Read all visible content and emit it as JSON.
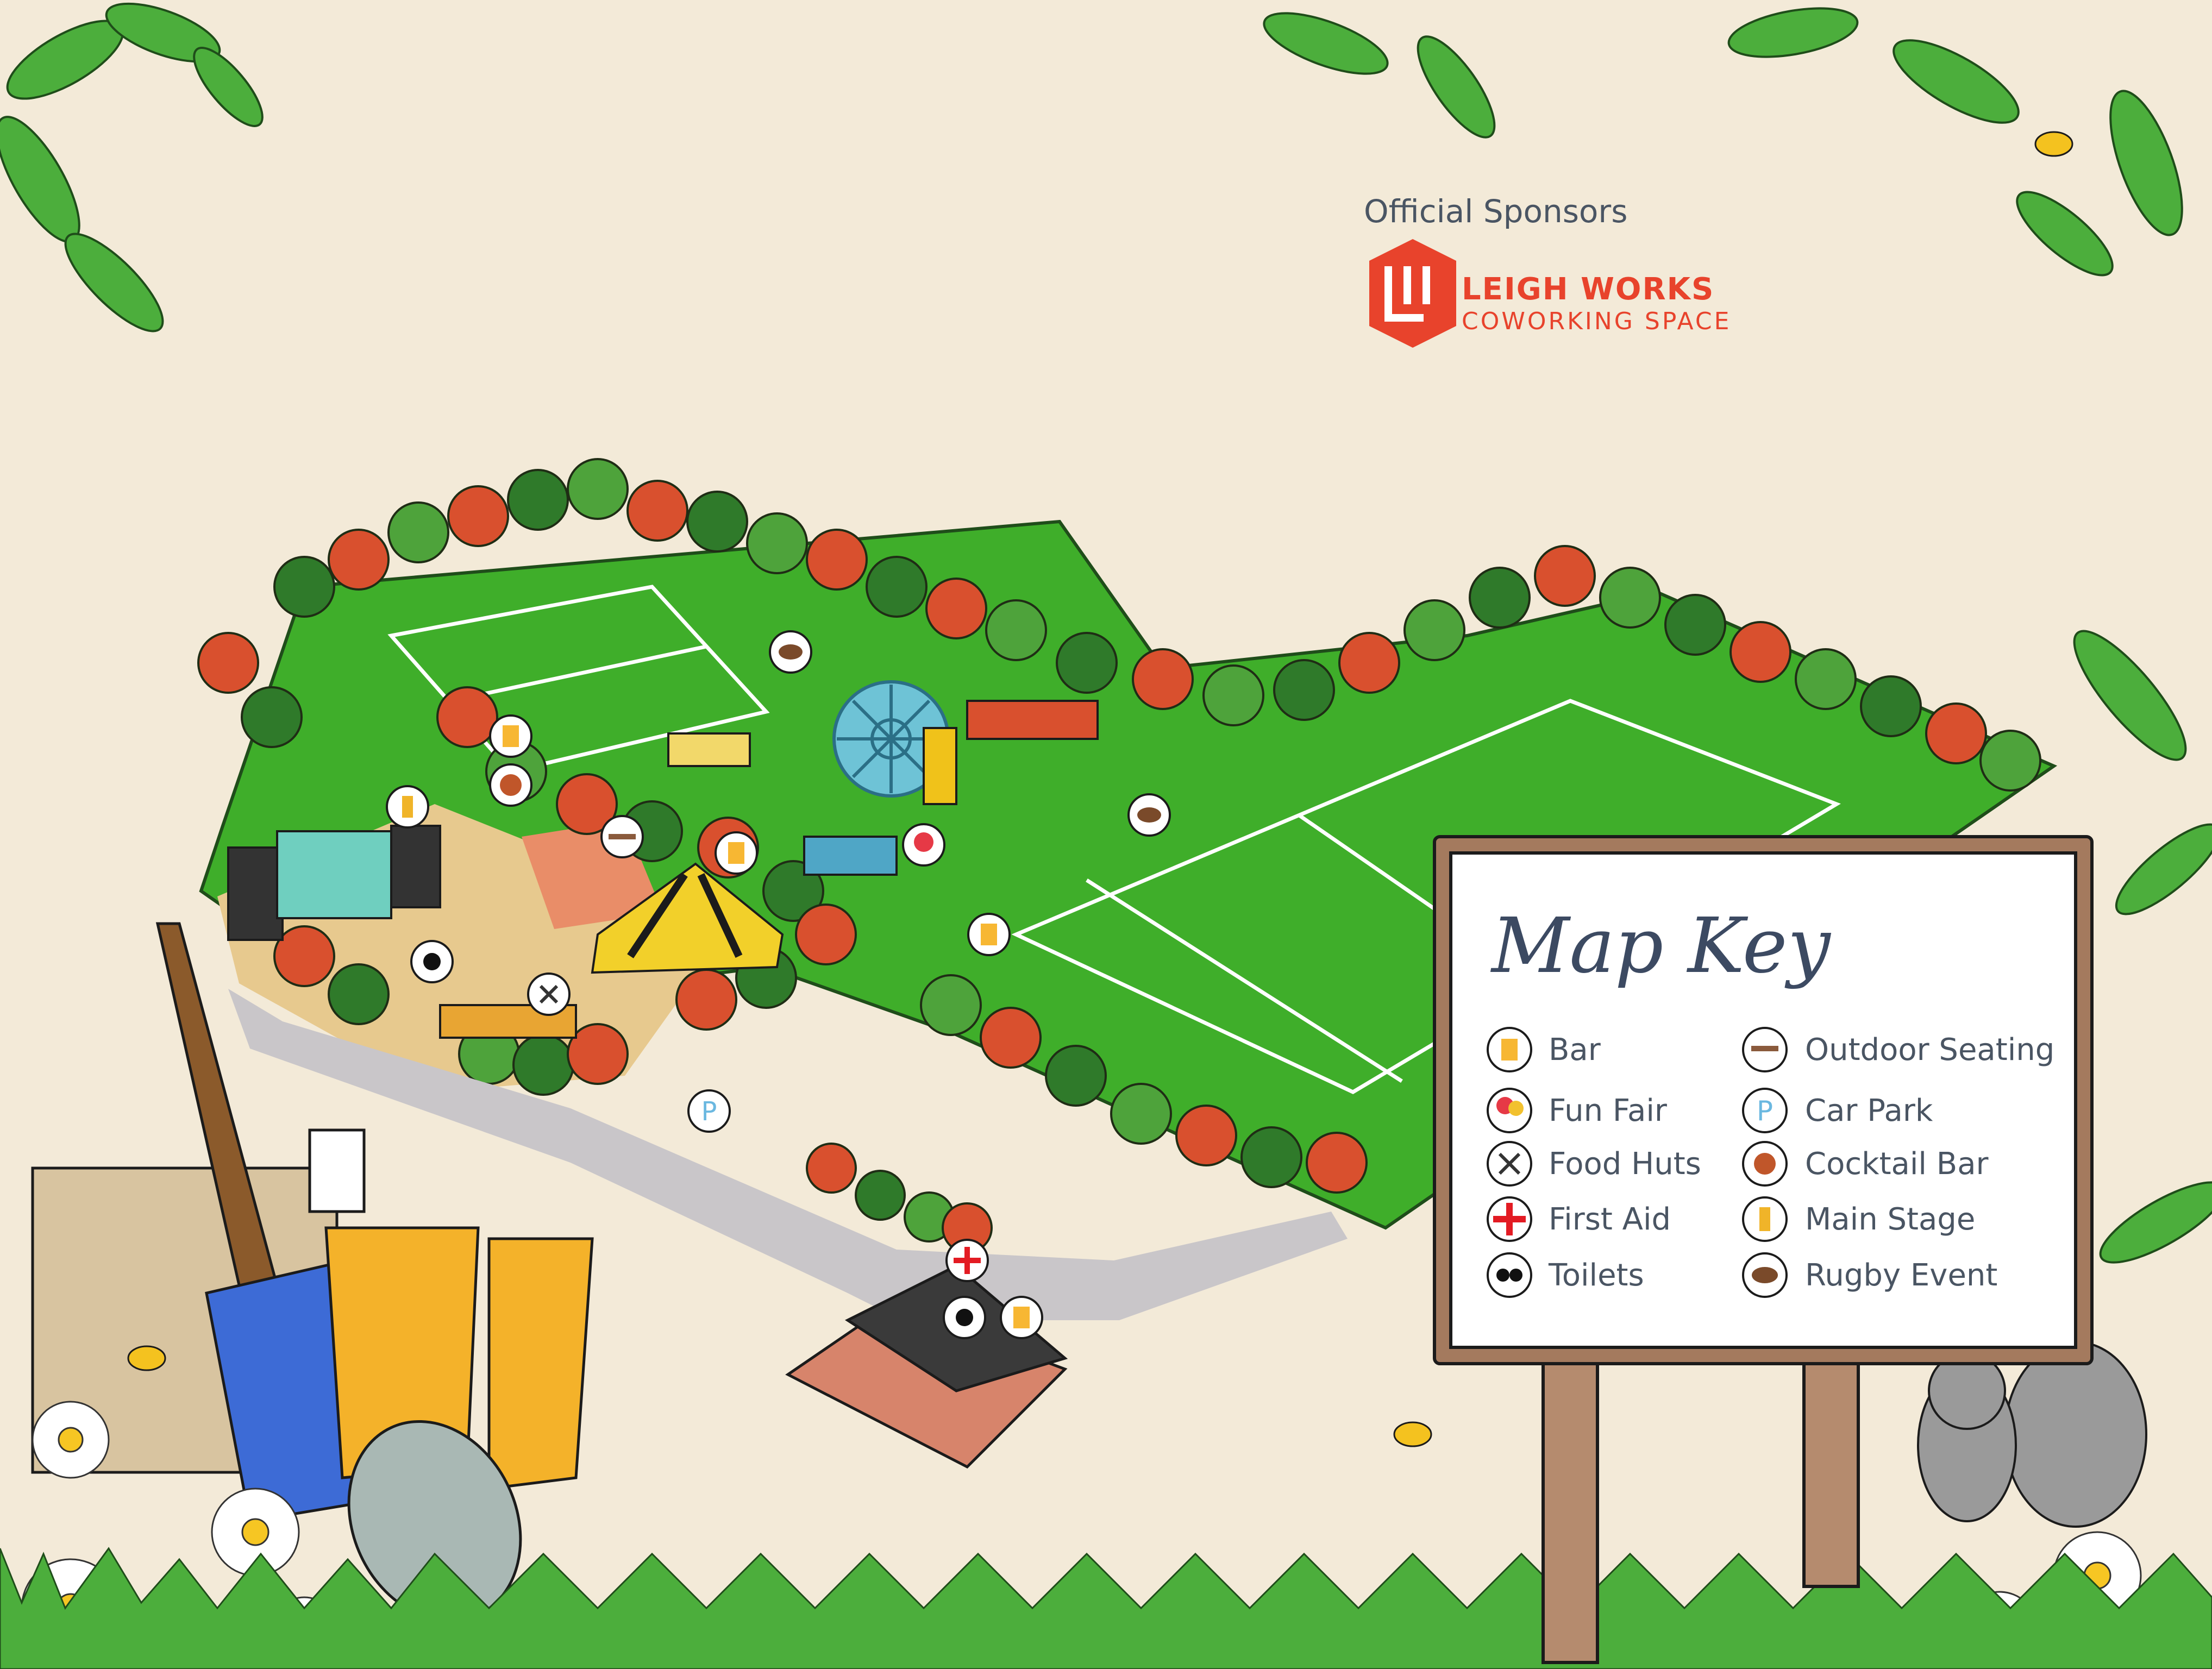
{
  "sponsors": {
    "heading": "Official Sponsors",
    "name": "LEIGH WORKS",
    "tagline": "COWORKING SPACE"
  },
  "map_key": {
    "title": "Map Key",
    "left": [
      {
        "label": "Bar",
        "icon": "beer-glass-icon",
        "color": "#f7b733"
      },
      {
        "label": "Fun Fair",
        "icon": "balloons-icon",
        "color": "#e63946"
      },
      {
        "label": "Food Huts",
        "icon": "fork-knife-icon",
        "color": "#333333"
      },
      {
        "label": "First Aid",
        "icon": "red-cross-icon",
        "color": "#e31b23"
      },
      {
        "label": "Toilets",
        "icon": "toilets-icon",
        "color": "#111111"
      }
    ],
    "right": [
      {
        "label": "Outdoor Seating",
        "icon": "picnic-bench-icon",
        "color": "#8a5a3c"
      },
      {
        "label": "Car Park",
        "icon": "parking-icon",
        "color": "#6bb8e0"
      },
      {
        "label": "Cocktail Bar",
        "icon": "cocktail-icon",
        "color": "#c0562a"
      },
      {
        "label": "Main Stage",
        "icon": "guitar-icon",
        "color": "#f0b429"
      },
      {
        "label": "Rugby Event",
        "icon": "rugby-ball-icon",
        "color": "#7a4a2a"
      }
    ]
  },
  "colors": {
    "background": "#f3ead8",
    "grass": "#3fae2a",
    "sponsor_red": "#e8432c",
    "sign_wood": "#a47a5e"
  }
}
